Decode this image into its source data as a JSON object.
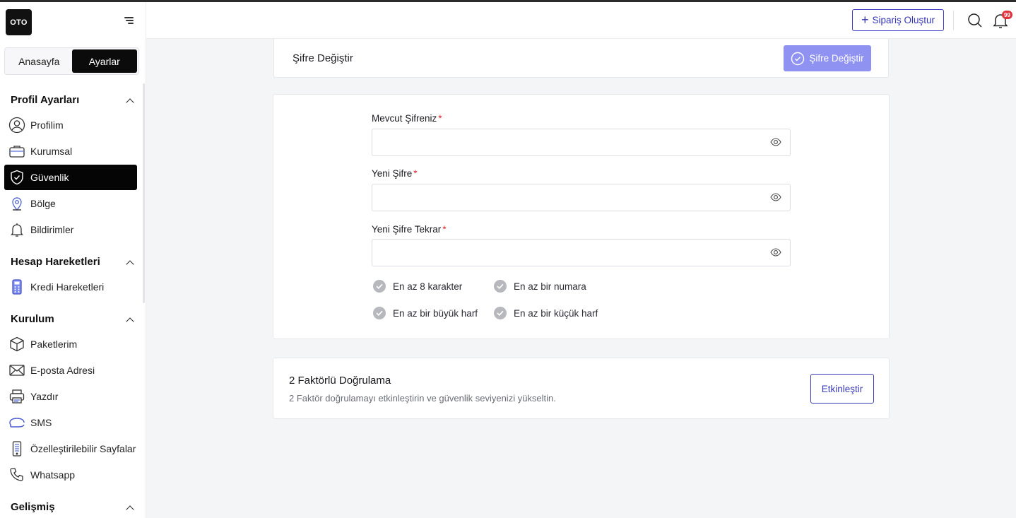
{
  "app": {
    "logo_text": "OTO"
  },
  "sidebar": {
    "tabs": [
      {
        "label": "Anasayfa",
        "active": false
      },
      {
        "label": "Ayarlar",
        "active": true
      }
    ],
    "sections": [
      {
        "title": "Profil Ayarları",
        "items": [
          {
            "label": "Profilim",
            "icon": "user-icon"
          },
          {
            "label": "Kurumsal",
            "icon": "briefcase-icon"
          },
          {
            "label": "Güvenlik",
            "icon": "shield-icon",
            "active": true
          },
          {
            "label": "Bölge",
            "icon": "location-pin-icon"
          },
          {
            "label": "Bildirimler",
            "icon": "bell-icon"
          }
        ]
      },
      {
        "title": "Hesap Hareketleri",
        "items": [
          {
            "label": "Kredi Hareketleri",
            "icon": "calculator-icon"
          }
        ]
      },
      {
        "title": "Kurulum",
        "items": [
          {
            "label": "Paketlerim",
            "icon": "box-icon"
          },
          {
            "label": "E-posta Adresi",
            "icon": "envelope-icon"
          },
          {
            "label": "Yazdır",
            "icon": "printer-icon"
          },
          {
            "label": "SMS",
            "icon": "chat-bubble-icon"
          },
          {
            "label": "Özelleştirilebilir Sayfalar",
            "icon": "mobile-page-icon"
          },
          {
            "label": "Whatsapp",
            "icon": "phone-icon"
          }
        ]
      },
      {
        "title": "Gelişmiş",
        "items": []
      }
    ]
  },
  "header": {
    "create_order_label": "Sipariş Oluştur",
    "notification_count": "99"
  },
  "page": {
    "title": "Şifre Değiştir",
    "submit_label": "Şifre Değiştir",
    "fields": {
      "current": {
        "label": "Mevcut Şifreniz",
        "required_mark": "*",
        "value": ""
      },
      "new": {
        "label": "Yeni Şifre",
        "required_mark": "*",
        "value": ""
      },
      "confirm": {
        "label": "Yeni Şifre Tekrar",
        "required_mark": "*",
        "value": ""
      }
    },
    "rules": [
      "En az 8 karakter",
      "En az bir numara",
      "En az bir büyük harf",
      "En az bir küçük harf"
    ],
    "two_factor": {
      "title": "2 Faktörlü Doğrulama",
      "description": "2 Faktör doğrulamayı etkinleştirin ve güvenlik seviyenizi yükseltin.",
      "button_label": "Etkinleştir"
    }
  },
  "colors": {
    "accent": "#3a3ab8",
    "accent_disabled": "#8f92f0",
    "active_nav": "#050505",
    "required": "#e0242f",
    "badge": "#e0323a"
  }
}
